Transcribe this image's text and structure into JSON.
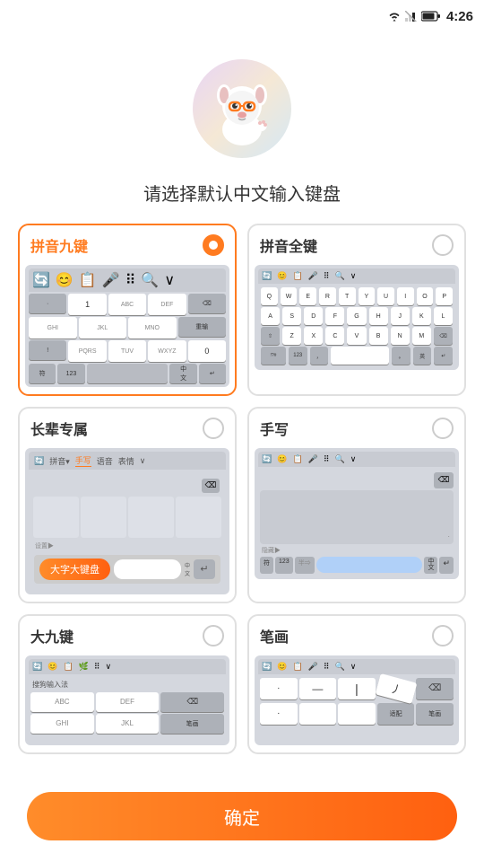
{
  "statusBar": {
    "time": "4:26"
  },
  "header": {
    "title": "请选择默认中文输入键盘"
  },
  "confirm": {
    "label": "确定"
  },
  "keyboards": [
    {
      "id": "nine-key",
      "title": "拼音九键",
      "selected": true,
      "type": "nine-key"
    },
    {
      "id": "full-key",
      "title": "拼音全键",
      "selected": false,
      "type": "full-key"
    },
    {
      "id": "elder",
      "title": "长辈专属",
      "selected": false,
      "type": "elder"
    },
    {
      "id": "handwrite",
      "title": "手写",
      "selected": false,
      "type": "handwrite"
    },
    {
      "id": "big-nine",
      "title": "大九键",
      "selected": false,
      "type": "big-nine"
    },
    {
      "id": "stroke",
      "title": "笔画",
      "selected": false,
      "type": "stroke"
    }
  ],
  "nineKeyRows": [
    [
      "·",
      "1",
      "ABC",
      "DEF",
      "⌫"
    ],
    [
      "GHI",
      "JKL",
      "MNO",
      "重输"
    ],
    [
      "!",
      "PQRS",
      "TUV",
      "WXYZ",
      "0"
    ],
    [
      "符",
      "123",
      "　",
      "中",
      "↵"
    ]
  ],
  "fullKeyRows": [
    [
      "Q",
      "W",
      "E",
      "R",
      "T",
      "Y",
      "U",
      "I",
      "O",
      "P"
    ],
    [
      "A",
      "S",
      "D",
      "F",
      "G",
      "H",
      "J",
      "K",
      "L"
    ],
    [
      "⇧",
      "Z",
      "X",
      "C",
      "V",
      "B",
      "N",
      "M",
      "⌫"
    ],
    [
      "!?#",
      "123",
      "，",
      "　",
      "。",
      "英",
      "↵"
    ]
  ],
  "strokeRows": [
    [
      "·",
      "—",
      "|",
      "丿",
      "⌫"
    ],
    [
      "·",
      "",
      "",
      "",
      "适配",
      "笔画"
    ]
  ]
}
